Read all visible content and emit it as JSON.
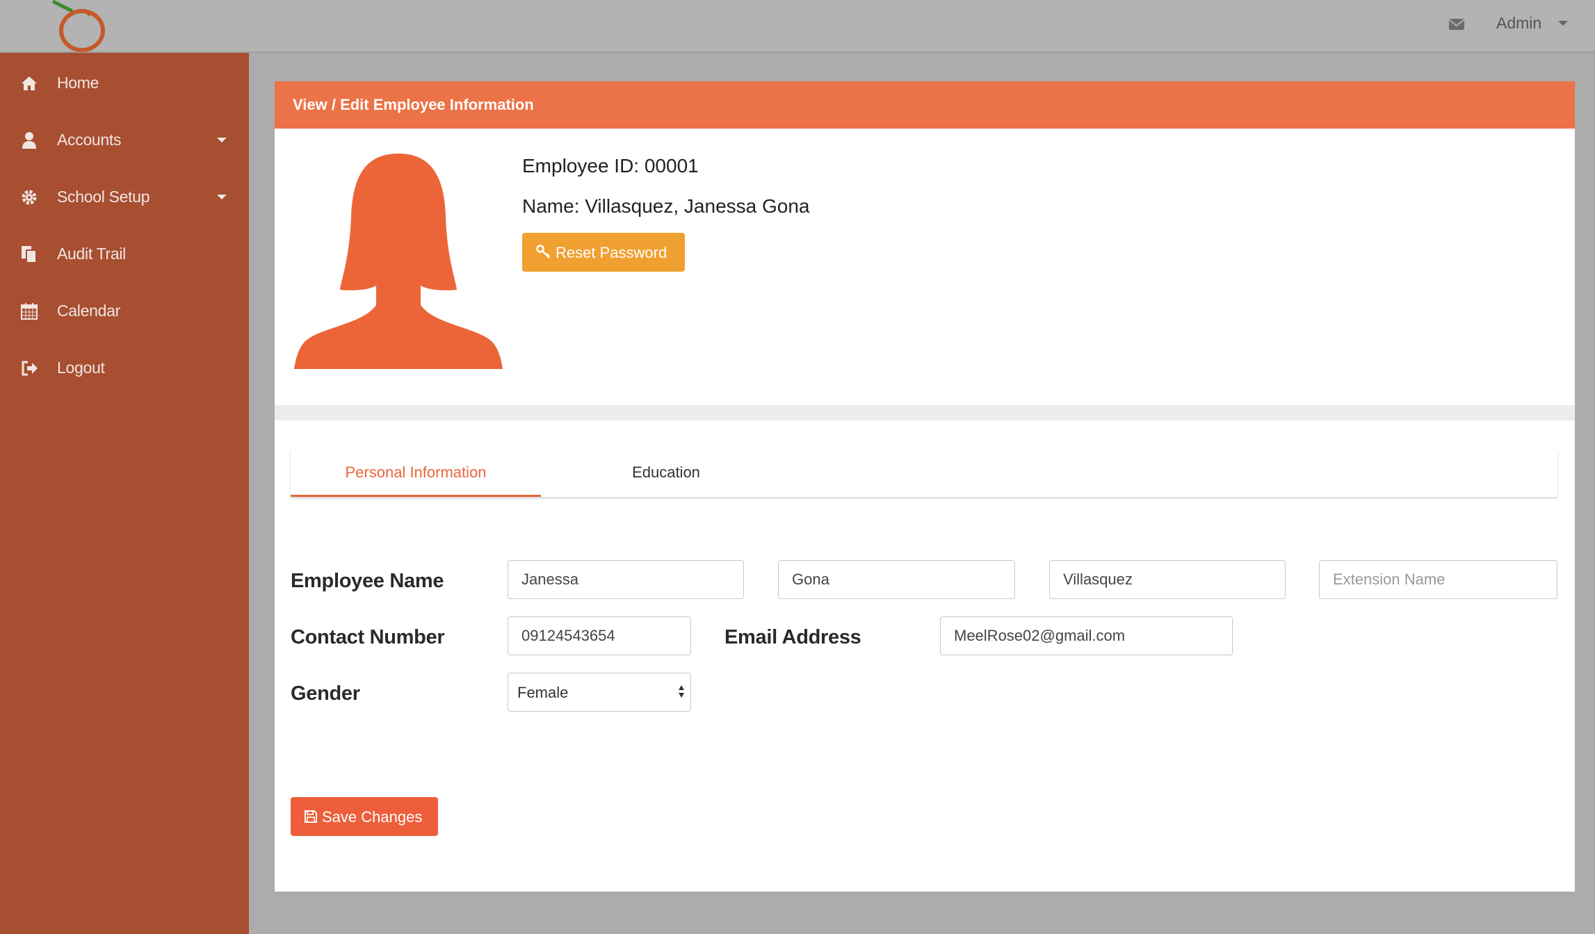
{
  "header": {
    "user_label": "Admin"
  },
  "sidebar": {
    "items": [
      {
        "label": "Home",
        "icon": "home-icon"
      },
      {
        "label": "Accounts",
        "icon": "user-icon"
      },
      {
        "label": "School Setup",
        "icon": "gear-icon"
      },
      {
        "label": "Audit Trail",
        "icon": "copy-icon"
      },
      {
        "label": "Calendar",
        "icon": "calendar-icon"
      },
      {
        "label": "Logout",
        "icon": "sign-out-icon"
      }
    ]
  },
  "panel": {
    "title": "View / Edit Employee Information",
    "employee_id": "Employee ID: 00001",
    "employee_name": "Name: Villasquez, Janessa Gona",
    "reset_label": "Reset Password"
  },
  "tabs": [
    {
      "label": "Personal Information",
      "active": true
    },
    {
      "label": "Education",
      "active": false
    }
  ],
  "form": {
    "employee_name_label": "Employee Name",
    "first_name": "Janessa",
    "middle_name": "Gona",
    "last_name": "Villasquez",
    "extension_placeholder": "Extension Name",
    "contact_label": "Contact Number",
    "contact_value": "09124543654",
    "email_label": "Email Address",
    "email_value": "MeelRose02@gmail.com",
    "gender_label": "Gender",
    "gender_value": "Female",
    "save_label": "Save Changes"
  },
  "colors": {
    "sidebar": "#a84e31",
    "accent": "#ec7247",
    "reset_button": "#f0a030",
    "save_button": "#ec5f3a"
  }
}
